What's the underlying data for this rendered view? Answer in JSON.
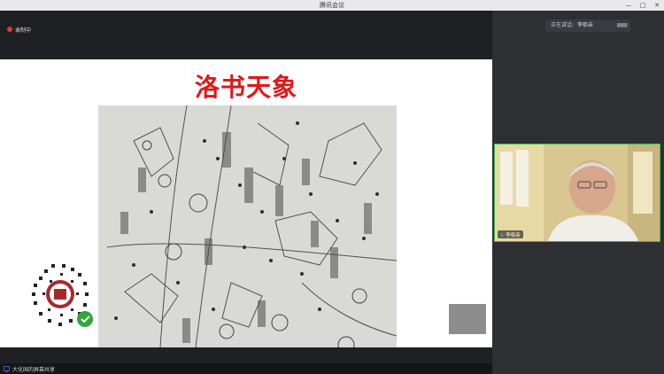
{
  "window": {
    "title": "腾讯会议",
    "controls": [
      "—",
      "□",
      "✕"
    ]
  },
  "recording": {
    "label": "录制中",
    "color": "#e2382e"
  },
  "slide": {
    "title": "洛书天象"
  },
  "share_bar": {
    "label": "大化国的屏幕共享"
  },
  "speaker": {
    "label": "正在讲话:",
    "name": "李栢亲"
  },
  "video": {
    "name": "李栢亲"
  },
  "colors": {
    "accent_green": "#33c24d",
    "title_red": "#e01818"
  }
}
